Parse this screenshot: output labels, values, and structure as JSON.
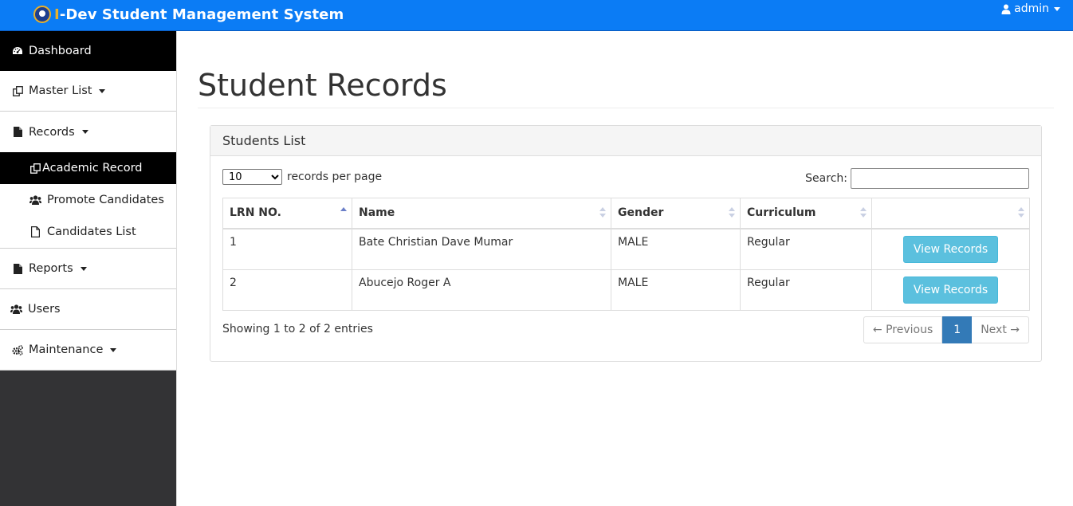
{
  "app": {
    "brand_prefix": "I",
    "brand_rest": "-Dev Student Management System"
  },
  "header": {
    "user_label": "admin"
  },
  "sidebar": {
    "items": [
      {
        "label": "Dashboard",
        "icon": "dashboard-icon",
        "active": true
      },
      {
        "label": "Master List",
        "icon": "copy-icon"
      },
      {
        "label": "Records",
        "icon": "file-icon"
      },
      {
        "label": "Reports",
        "icon": "file-icon"
      },
      {
        "label": "Users",
        "icon": "users-icon"
      },
      {
        "label": "Maintenance",
        "icon": "gears-icon"
      }
    ],
    "records_sub": [
      {
        "label": "Academic Record",
        "icon": "copy-icon",
        "active": true
      },
      {
        "label": "Promote Candidates",
        "icon": "users-icon"
      },
      {
        "label": "Candidates List",
        "icon": "file-outline-icon"
      }
    ]
  },
  "main": {
    "title": "Student Records",
    "panel_title": "Students List",
    "length_value": "10",
    "length_label": "records per page",
    "search_label": "Search:",
    "search_value": "",
    "columns": [
      "LRN NO.",
      "Name",
      "Gender",
      "Curriculum",
      ""
    ],
    "rows": [
      {
        "lrn": "1",
        "name": "Bate Christian Dave Mumar",
        "gender": "MALE",
        "curriculum": "Regular",
        "action": "View Records"
      },
      {
        "lrn": "2",
        "name": "Abucejo Roger A",
        "gender": "MALE",
        "curriculum": "Regular",
        "action": "View Records"
      }
    ],
    "info": "Showing 1 to 2 of 2 entries",
    "pager": {
      "prev": "← Previous",
      "current": "1",
      "next": "Next →"
    }
  }
}
